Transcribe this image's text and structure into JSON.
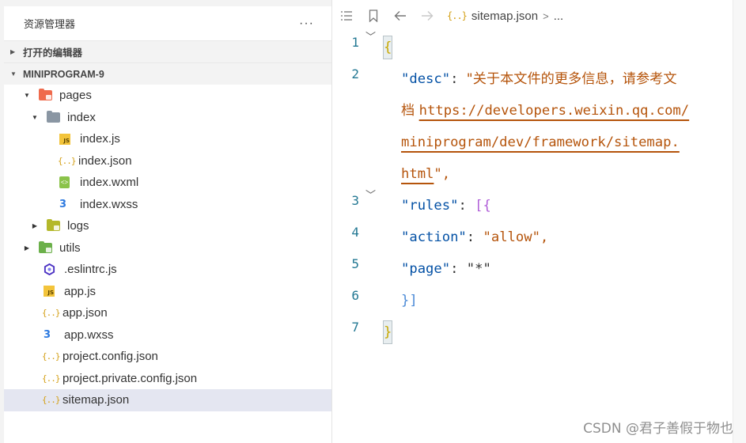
{
  "explorer": {
    "title": "资源管理器",
    "more_label": "···",
    "open_editors_label": "打开的编辑器",
    "project_label": "MINIPROGRAM-9",
    "tree": [
      {
        "label": "pages",
        "icon": "pages-folder-icon"
      },
      {
        "label": "index",
        "icon": "folder-icon"
      },
      {
        "label": "index.js",
        "icon": "js-file-icon"
      },
      {
        "label": "index.json",
        "icon": "json-file-icon"
      },
      {
        "label": "index.wxml",
        "icon": "wxml-file-icon"
      },
      {
        "label": "index.wxss",
        "icon": "css-file-icon"
      },
      {
        "label": "logs",
        "icon": "folder-icon"
      },
      {
        "label": "utils",
        "icon": "utils-folder-icon"
      },
      {
        "label": ".eslintrc.js",
        "icon": "eslint-icon"
      },
      {
        "label": "app.js",
        "icon": "js-file-icon"
      },
      {
        "label": "app.json",
        "icon": "json-file-icon"
      },
      {
        "label": "app.wxss",
        "icon": "css-file-icon"
      },
      {
        "label": "project.config.json",
        "icon": "json-file-icon"
      },
      {
        "label": "project.private.config.json",
        "icon": "json-file-icon"
      },
      {
        "label": "sitemap.json",
        "icon": "json-file-icon"
      }
    ]
  },
  "editor": {
    "breadcrumb_file": "sitemap.json",
    "breadcrumb_more": "...",
    "line_numbers": [
      "1",
      "2",
      "3",
      "4",
      "5",
      "6",
      "7"
    ],
    "code": {
      "l1_brace": "{",
      "desc_key": "\"desc\"",
      "desc_text_a": "\"关于本文件的更多信息，请参考文",
      "desc_text_b": "档 ",
      "url_a": "https://developers.weixin.qq.com/",
      "url_b": "miniprogram/dev/framework/sitemap.",
      "url_c": "html",
      "url_end": "\",",
      "rules_key": "\"rules\"",
      "rules_open": "[{",
      "action_key": "\"action\"",
      "action_val": "\"allow\",",
      "page_key": "\"page\"",
      "page_val": "\"*\"",
      "rules_close": "}]",
      "l7_brace": "}",
      "colon": ": "
    }
  },
  "watermark": "CSDN @君子善假于物也",
  "colors": {
    "line_number": "#237893",
    "json_key": "#0451a5",
    "json_string": "#a31515",
    "url": "#b5540b",
    "selection": "#e4e6f1"
  }
}
